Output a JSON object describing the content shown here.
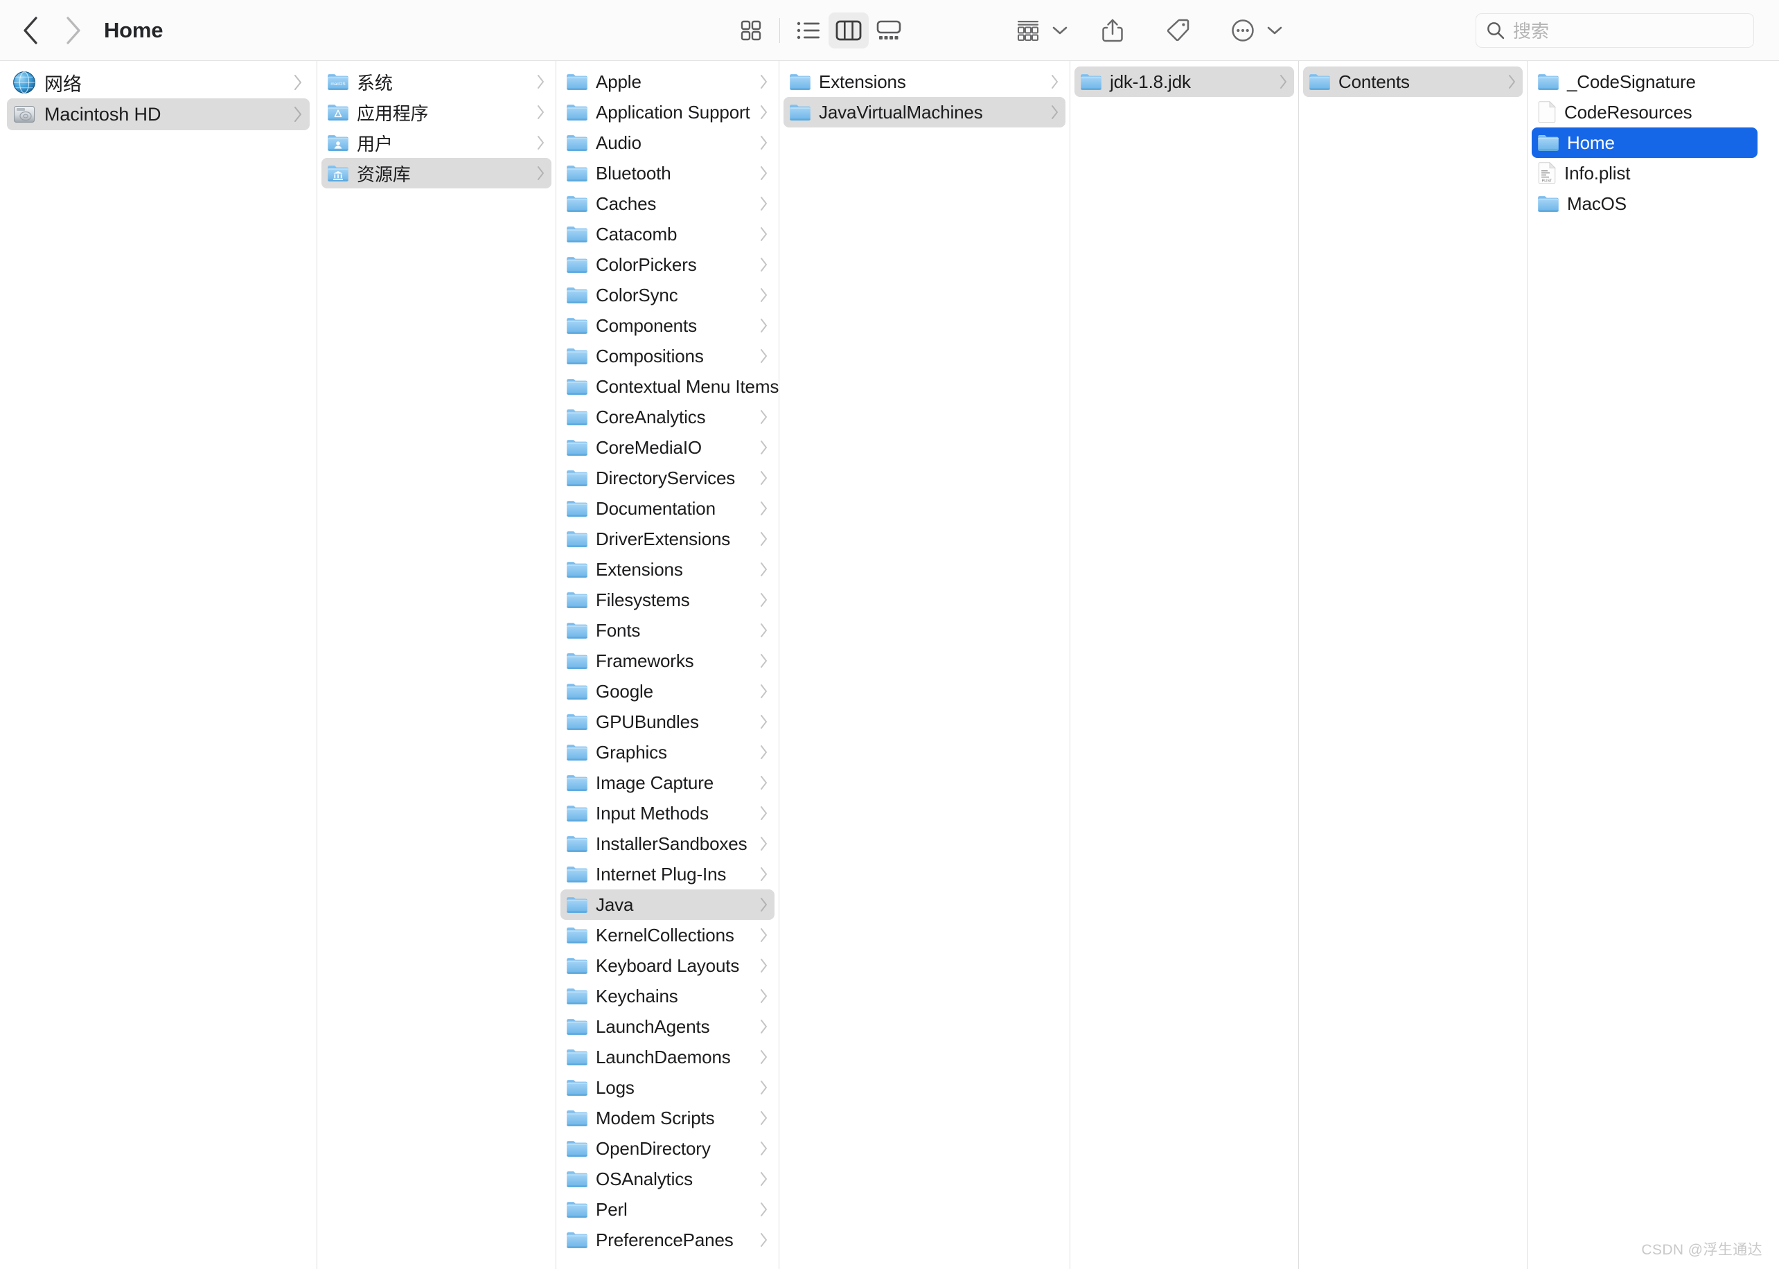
{
  "window": {
    "title": "Home",
    "back_label": "◀",
    "forward_label": "▶"
  },
  "toolbar": {
    "back_tooltip": "后退",
    "forward_tooltip": "前进",
    "view_icon_label": "图标视图",
    "view_list_label": "列表视图",
    "view_column_label": "分栏视图",
    "view_gallery_label": "画廊视图",
    "active_view": "column",
    "group_label": "排序方式",
    "share_label": "共享",
    "tag_label": "标记",
    "more_label": "更多"
  },
  "search": {
    "placeholder": "搜索",
    "value": ""
  },
  "sidebar": {
    "items": [
      {
        "label": "网络",
        "icon": "network-globe-icon",
        "selected": false,
        "chevron": true
      },
      {
        "label": "Macintosh HD",
        "icon": "hard-disk-icon",
        "selected": true,
        "chevron": true
      }
    ]
  },
  "columns": [
    {
      "name": "column-macintosh-hd",
      "items": [
        {
          "label": "系统",
          "icon": "folder-macos-icon",
          "selected": false,
          "chevron": true
        },
        {
          "label": "应用程序",
          "icon": "folder-applications-icon",
          "selected": false,
          "chevron": true
        },
        {
          "label": "用户",
          "icon": "folder-users-icon",
          "selected": false,
          "chevron": true
        },
        {
          "label": "资源库",
          "icon": "folder-library-icon",
          "selected": true,
          "chevron": true
        }
      ]
    },
    {
      "name": "column-library",
      "items": [
        {
          "label": "Apple",
          "icon": "folder-icon",
          "selected": false,
          "chevron": true
        },
        {
          "label": "Application Support",
          "icon": "folder-icon",
          "selected": false,
          "chevron": true
        },
        {
          "label": "Audio",
          "icon": "folder-icon",
          "selected": false,
          "chevron": true
        },
        {
          "label": "Bluetooth",
          "icon": "folder-icon",
          "selected": false,
          "chevron": true
        },
        {
          "label": "Caches",
          "icon": "folder-icon",
          "selected": false,
          "chevron": true
        },
        {
          "label": "Catacomb",
          "icon": "folder-icon",
          "selected": false,
          "chevron": true
        },
        {
          "label": "ColorPickers",
          "icon": "folder-icon",
          "selected": false,
          "chevron": true
        },
        {
          "label": "ColorSync",
          "icon": "folder-icon",
          "selected": false,
          "chevron": true
        },
        {
          "label": "Components",
          "icon": "folder-icon",
          "selected": false,
          "chevron": true
        },
        {
          "label": "Compositions",
          "icon": "folder-icon",
          "selected": false,
          "chevron": true
        },
        {
          "label": "Contextual Menu Items",
          "icon": "folder-icon",
          "selected": false,
          "chevron": true
        },
        {
          "label": "CoreAnalytics",
          "icon": "folder-icon",
          "selected": false,
          "chevron": true
        },
        {
          "label": "CoreMediaIO",
          "icon": "folder-icon",
          "selected": false,
          "chevron": true
        },
        {
          "label": "DirectoryServices",
          "icon": "folder-icon",
          "selected": false,
          "chevron": true
        },
        {
          "label": "Documentation",
          "icon": "folder-icon",
          "selected": false,
          "chevron": true
        },
        {
          "label": "DriverExtensions",
          "icon": "folder-icon",
          "selected": false,
          "chevron": true
        },
        {
          "label": "Extensions",
          "icon": "folder-icon",
          "selected": false,
          "chevron": true
        },
        {
          "label": "Filesystems",
          "icon": "folder-icon",
          "selected": false,
          "chevron": true
        },
        {
          "label": "Fonts",
          "icon": "folder-icon",
          "selected": false,
          "chevron": true
        },
        {
          "label": "Frameworks",
          "icon": "folder-icon",
          "selected": false,
          "chevron": true
        },
        {
          "label": "Google",
          "icon": "folder-icon",
          "selected": false,
          "chevron": true
        },
        {
          "label": "GPUBundles",
          "icon": "folder-icon",
          "selected": false,
          "chevron": true
        },
        {
          "label": "Graphics",
          "icon": "folder-icon",
          "selected": false,
          "chevron": true
        },
        {
          "label": "Image Capture",
          "icon": "folder-icon",
          "selected": false,
          "chevron": true
        },
        {
          "label": "Input Methods",
          "icon": "folder-icon",
          "selected": false,
          "chevron": true
        },
        {
          "label": "InstallerSandboxes",
          "icon": "folder-icon",
          "selected": false,
          "chevron": true
        },
        {
          "label": "Internet Plug-Ins",
          "icon": "folder-icon",
          "selected": false,
          "chevron": true
        },
        {
          "label": "Java",
          "icon": "folder-icon",
          "selected": true,
          "chevron": true
        },
        {
          "label": "KernelCollections",
          "icon": "folder-icon",
          "selected": false,
          "chevron": true
        },
        {
          "label": "Keyboard Layouts",
          "icon": "folder-icon",
          "selected": false,
          "chevron": true
        },
        {
          "label": "Keychains",
          "icon": "folder-icon",
          "selected": false,
          "chevron": true
        },
        {
          "label": "LaunchAgents",
          "icon": "folder-icon",
          "selected": false,
          "chevron": true
        },
        {
          "label": "LaunchDaemons",
          "icon": "folder-icon",
          "selected": false,
          "chevron": true
        },
        {
          "label": "Logs",
          "icon": "folder-icon",
          "selected": false,
          "chevron": true
        },
        {
          "label": "Modem Scripts",
          "icon": "folder-icon",
          "selected": false,
          "chevron": true
        },
        {
          "label": "OpenDirectory",
          "icon": "folder-icon",
          "selected": false,
          "chevron": true
        },
        {
          "label": "OSAnalytics",
          "icon": "folder-icon",
          "selected": false,
          "chevron": true
        },
        {
          "label": "Perl",
          "icon": "folder-icon",
          "selected": false,
          "chevron": true
        },
        {
          "label": "PreferencePanes",
          "icon": "folder-icon",
          "selected": false,
          "chevron": true
        }
      ]
    },
    {
      "name": "column-java",
      "items": [
        {
          "label": "Extensions",
          "icon": "folder-icon",
          "selected": false,
          "chevron": true
        },
        {
          "label": "JavaVirtualMachines",
          "icon": "folder-icon",
          "selected": true,
          "chevron": true
        }
      ]
    },
    {
      "name": "column-javavirtualmachines",
      "items": [
        {
          "label": "jdk-1.8.jdk",
          "icon": "folder-icon",
          "selected": true,
          "chevron": true
        }
      ]
    },
    {
      "name": "column-jdk",
      "items": [
        {
          "label": "Contents",
          "icon": "folder-icon",
          "selected": true,
          "chevron": true
        }
      ]
    },
    {
      "name": "column-contents",
      "items": [
        {
          "label": "_CodeSignature",
          "icon": "folder-icon",
          "selected": false,
          "chevron": false
        },
        {
          "label": "CodeResources",
          "icon": "document-blank-icon",
          "selected": false,
          "chevron": false
        },
        {
          "label": "Home",
          "icon": "folder-icon",
          "selected": "blue",
          "chevron": false
        },
        {
          "label": "Info.plist",
          "icon": "document-plist-icon",
          "selected": false,
          "chevron": false
        },
        {
          "label": "MacOS",
          "icon": "folder-icon",
          "selected": false,
          "chevron": false
        }
      ]
    }
  ],
  "watermark": {
    "text": "CSDN @浮生通达"
  },
  "colors": {
    "selection_blue": "#1667e8",
    "selection_gray": "#dcdcdc",
    "folder_blue": "#6cb2ed",
    "toolbar_bg": "#fbfbfb",
    "divider": "#dedede"
  }
}
